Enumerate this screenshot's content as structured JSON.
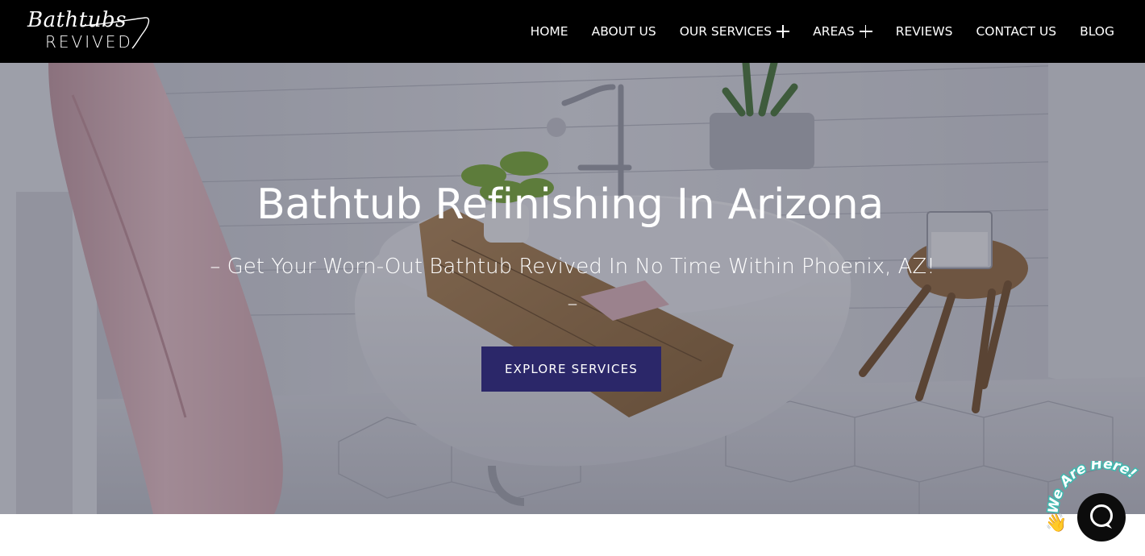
{
  "brand": {
    "script": "Bathtubs",
    "caps": "REVIVED"
  },
  "nav": {
    "items": [
      {
        "label": "HOME",
        "has_submenu": false
      },
      {
        "label": "ABOUT US",
        "has_submenu": false
      },
      {
        "label": "OUR SERVICES",
        "has_submenu": true
      },
      {
        "label": "AREAS",
        "has_submenu": true
      },
      {
        "label": "REVIEWS",
        "has_submenu": false
      },
      {
        "label": "CONTACT US",
        "has_submenu": false
      },
      {
        "label": "BLOG",
        "has_submenu": false
      }
    ]
  },
  "hero": {
    "title": "Bathtub Refinishing In Arizona",
    "subtitle": "– Get Your Worn-Out Bathtub Revived In No Time Within Phoenix, AZ! –",
    "cta_label": "EXPLORE SERVICES",
    "image": "bathroom-clawfoot-tub-photo"
  },
  "chat": {
    "badge_text": "We Are Here!",
    "icon": "chat-bubble-icon",
    "wave": "👋"
  },
  "colors": {
    "header_bg": "#000000",
    "cta_bg": "#2b2769",
    "text_light": "#ffffff",
    "chat_badge": "#3fb9b0"
  }
}
